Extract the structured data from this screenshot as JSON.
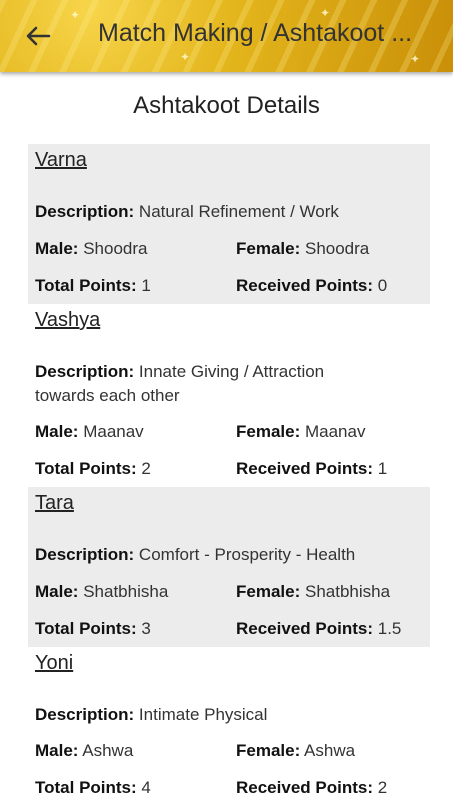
{
  "appbar": {
    "title": "Match Making / Ashtakoot ..."
  },
  "page": {
    "heading": "Ashtakoot Details"
  },
  "labels": {
    "description": "Description:",
    "male": "Male:",
    "female": "Female:",
    "total": "Total Points:",
    "received": "Received Points:"
  },
  "kootas": [
    {
      "name": "Varna",
      "description": "Natural Refinement / Work",
      "male": "Shoodra",
      "female": "Shoodra",
      "total_points": "1",
      "received_points": "0"
    },
    {
      "name": "Vashya",
      "description": "Innate Giving / Attraction towards each other",
      "male": "Maanav",
      "female": "Maanav",
      "total_points": "2",
      "received_points": "1"
    },
    {
      "name": "Tara",
      "description": "Comfort - Prosperity - Health",
      "male": "Shatbhisha",
      "female": "Shatbhisha",
      "total_points": "3",
      "received_points": "1.5"
    },
    {
      "name": "Yoni",
      "description": "Intimate Physical",
      "male": "Ashwa",
      "female": "Ashwa",
      "total_points": "4",
      "received_points": "2"
    }
  ]
}
